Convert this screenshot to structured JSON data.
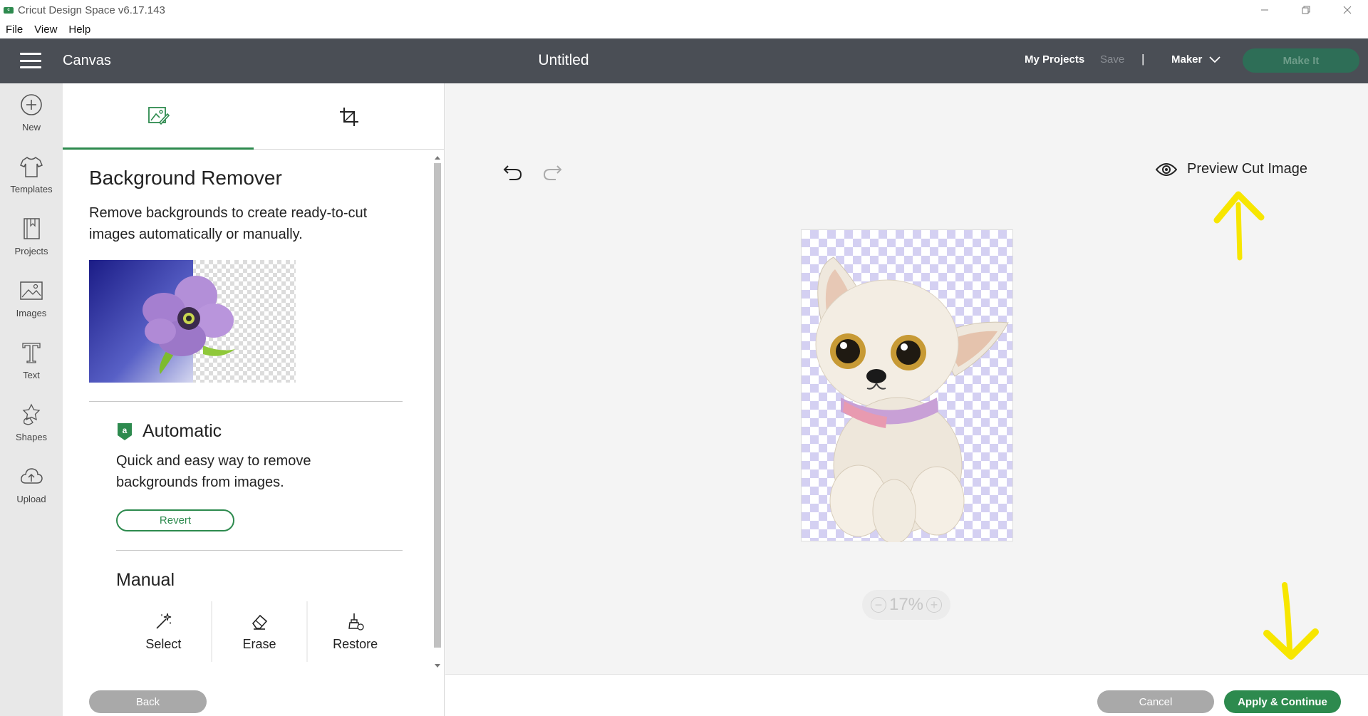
{
  "window": {
    "title": "Cricut Design Space  v6.17.143"
  },
  "menu": {
    "items": [
      "File",
      "View",
      "Help"
    ]
  },
  "header": {
    "section": "Canvas",
    "document_title": "Untitled",
    "my_projects": "My Projects",
    "save": "Save",
    "separator": "|",
    "machine": "Maker",
    "make_it": "Make It"
  },
  "sidebar": {
    "items": [
      {
        "label": "New",
        "icon": "plus-circle-icon"
      },
      {
        "label": "Templates",
        "icon": "tshirt-icon"
      },
      {
        "label": "Projects",
        "icon": "notebook-icon"
      },
      {
        "label": "Images",
        "icon": "image-icon"
      },
      {
        "label": "Text",
        "icon": "text-t-icon"
      },
      {
        "label": "Shapes",
        "icon": "shapes-icon"
      },
      {
        "label": "Upload",
        "icon": "cloud-upload-icon"
      }
    ]
  },
  "panel": {
    "tabs": [
      {
        "icon": "background-remover-icon",
        "active": true
      },
      {
        "icon": "crop-icon",
        "active": false
      }
    ],
    "title": "Background Remover",
    "description": "Remove backgrounds to create ready-to-cut images automatically or manually.",
    "automatic": {
      "title": "Automatic",
      "description": "Quick and easy way to remove backgrounds from images.",
      "revert": "Revert"
    },
    "manual": {
      "title": "Manual",
      "tools": [
        {
          "label": "Select",
          "icon": "magic-wand-icon"
        },
        {
          "label": "Erase",
          "icon": "eraser-icon"
        },
        {
          "label": "Restore",
          "icon": "restore-brush-icon"
        }
      ]
    },
    "back": "Back"
  },
  "canvas": {
    "preview_cut": "Preview Cut Image",
    "zoom": "17%"
  },
  "footer": {
    "cancel": "Cancel",
    "apply": "Apply & Continue"
  },
  "colors": {
    "accent": "#2d8a4e",
    "header_bg": "#4a4e55",
    "annotation_arrow": "#f7e600"
  }
}
